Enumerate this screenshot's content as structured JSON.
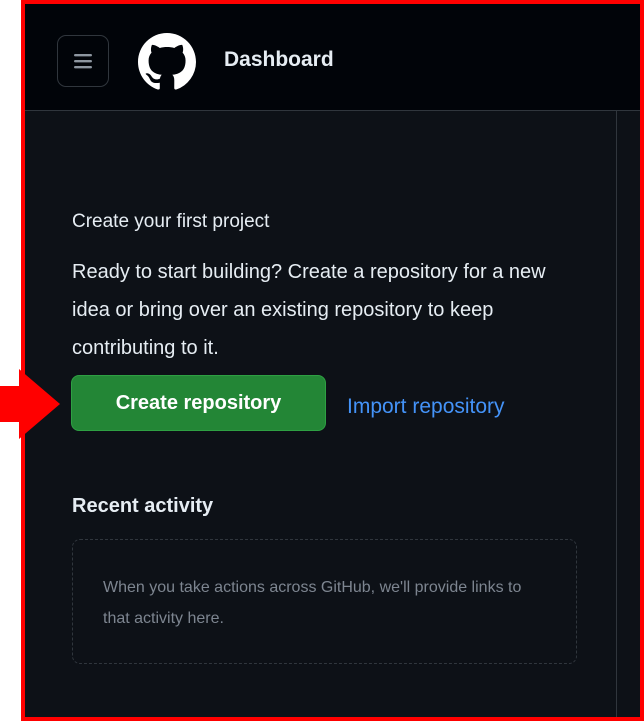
{
  "header": {
    "title": "Dashboard",
    "menu_icon": "hamburger-menu-icon",
    "logo_icon": "github-logo-icon"
  },
  "create_project": {
    "title": "Create your first project",
    "description": "Ready to start building? Create a repository for a new idea or bring over an existing repository to keep contributing to it.",
    "create_button": "Create repository",
    "import_link": "Import repository"
  },
  "recent_activity": {
    "title": "Recent activity",
    "empty_text": "When you take actions across GitHub, we'll provide links to that activity here."
  },
  "colors": {
    "accent_green": "#238636",
    "link_blue": "#4493f8",
    "background": "#0d1117",
    "annotation_red": "#ff0000"
  }
}
